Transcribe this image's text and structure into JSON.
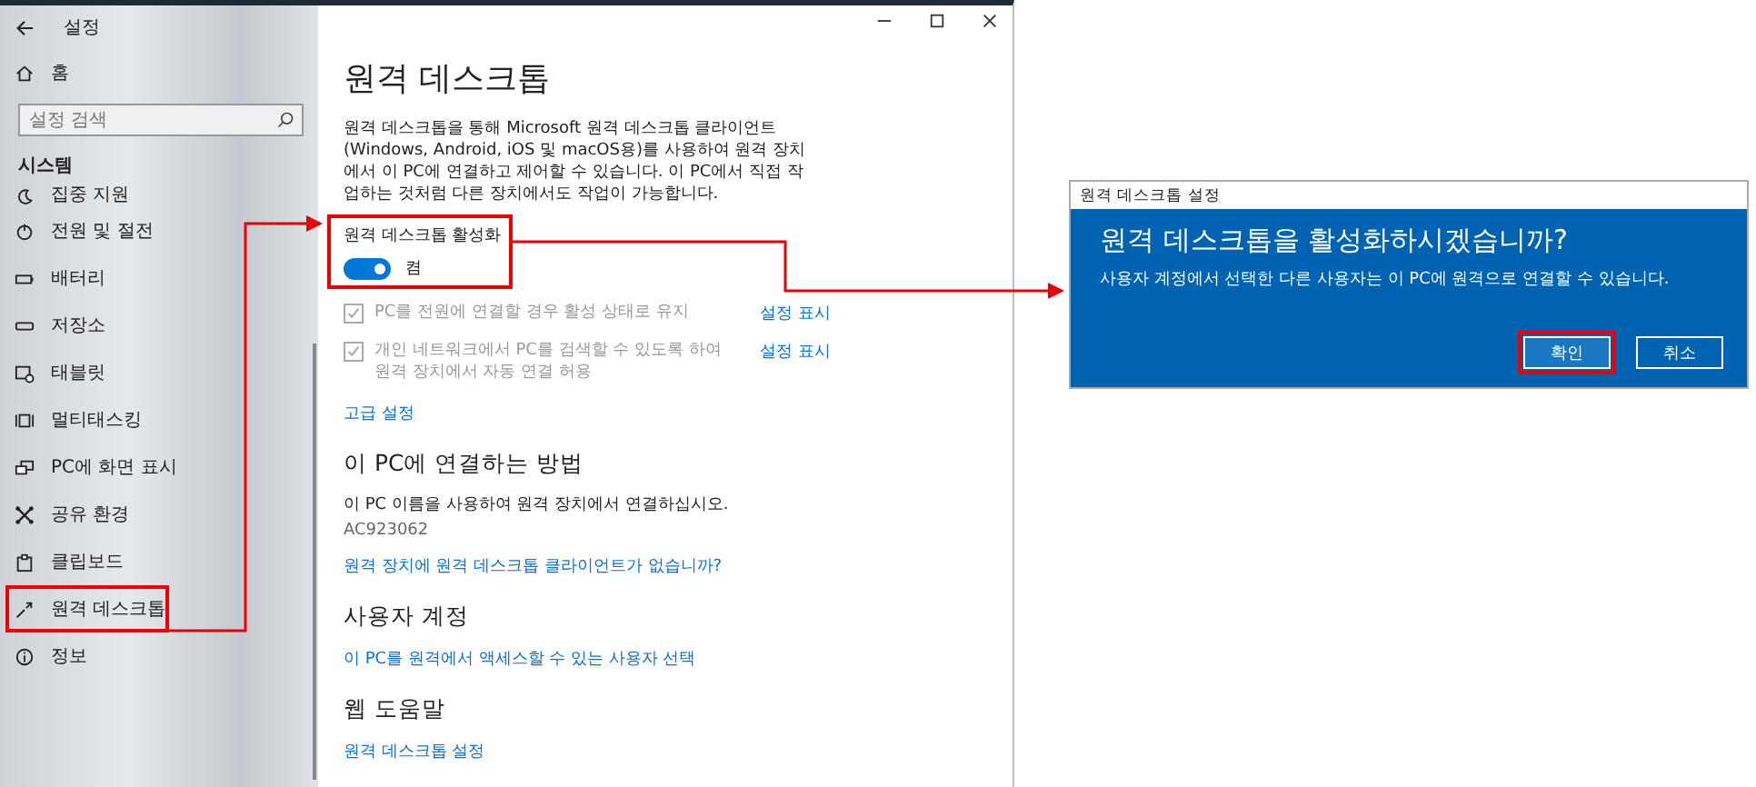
{
  "settings_window": {
    "title": "설정",
    "home": "홈",
    "search": {
      "placeholder": "설정 검색"
    },
    "section": "시스템",
    "sidebar": {
      "items": [
        {
          "label": "집중 지원",
          "highlighted": false
        },
        {
          "label": "전원 및 절전",
          "highlighted": false
        },
        {
          "label": "배터리",
          "highlighted": false
        },
        {
          "label": "저장소",
          "highlighted": false
        },
        {
          "label": "태블릿",
          "highlighted": false
        },
        {
          "label": "멀티태스킹",
          "highlighted": false
        },
        {
          "label": "PC에 화면 표시",
          "highlighted": false
        },
        {
          "label": "공유 환경",
          "highlighted": false
        },
        {
          "label": "클립보드",
          "highlighted": false
        },
        {
          "label": "원격 데스크톱",
          "highlighted": true
        },
        {
          "label": "정보",
          "highlighted": false
        }
      ]
    },
    "page": {
      "title": "원격 데스크톱",
      "description": "원격 데스크톱을 통해 Microsoft 원격 데스크톱 클라이언트(Windows, Android, iOS 및 macOS용)를 사용하여 원격 장치에서 이 PC에 연결하고 제어할 수 있습니다. 이 PC에서 직접 작업하는 것처럼 다른 장치에서도 작업이 가능합니다.",
      "toggle": {
        "label": "원격 데스크톱 활성화",
        "on": true,
        "state_text": "켬",
        "highlighted": true
      },
      "options": [
        {
          "text": "PC를 전원에 연결할 경우 활성 상태로 유지",
          "checked": true,
          "disabled": true,
          "link": "설정 표시"
        },
        {
          "text": "개인 네트워크에서 PC를 검색할 수 있도록 하여 원격 장치에서 자동 연결 허용",
          "checked": true,
          "disabled": true,
          "link": "설정 표시"
        }
      ],
      "advanced_link": "고급 설정",
      "sections": [
        {
          "heading": "이 PC에 연결하는 방법",
          "text": "이 PC 이름을 사용하여 원격 장치에서 연결하십시오.",
          "pc_name": "AC923062",
          "link": "원격 장치에 원격 데스크톱 클라이언트가 없습니까?"
        },
        {
          "heading": "사용자 계정",
          "link": "이 PC를 원격에서 액세스할 수 있는 사용자 선택"
        },
        {
          "heading": "웹 도움말",
          "link": "원격 데스크톱 설정"
        }
      ]
    }
  },
  "dialog": {
    "title": "원격 데스크톱 설정",
    "heading": "원격 데스크톱을 활성화하시겠습니까?",
    "message": "사용자 계정에서 선택한 다른 사용자는 이 PC에 원격으로 연결할 수 있습니다.",
    "buttons": [
      {
        "label": "확인",
        "highlighted": true
      },
      {
        "label": "취소",
        "highlighted": false
      }
    ]
  }
}
